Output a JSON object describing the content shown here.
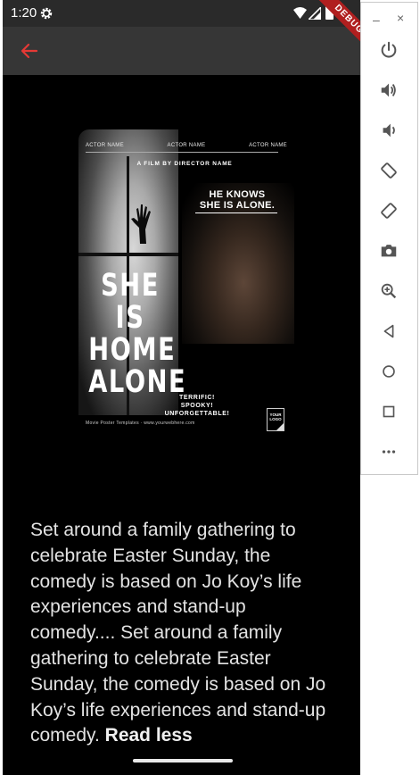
{
  "status_bar": {
    "time": "1:20",
    "icons": [
      "gear-icon",
      "wifi-icon",
      "signal-icon",
      "battery-icon"
    ]
  },
  "app_bar": {
    "back_icon": "arrow-back-icon",
    "accent": "#e53935"
  },
  "debug_banner": "DEBUG",
  "poster": {
    "actor_names": [
      "ACTOR NAME",
      "ACTOR NAME",
      "ACTOR NAME"
    ],
    "film_by": "A FILM BY DIRECTOR NAME",
    "tagline_line1": "HE KNOWS",
    "tagline_line2": "SHE IS ALONE.",
    "title_line1": "SHE IS",
    "title_line2": "HOME",
    "title_line3": "ALONE",
    "blurb_line1": "TERRIFIC!",
    "blurb_line2": "SPOOKY!",
    "blurb_line3": "UNFORGETTABLE!",
    "credits": "Movie Poster Templates · www.yourwebhere.com",
    "logo_line1": "YOUR",
    "logo_line2": "LOGO"
  },
  "description": {
    "text": "Set around a family gathering to celebrate Easter Sunday, the comedy is based on Jo Koy’s life experiences and stand-up comedy.... Set around a family gathering to celebrate Easter Sunday, the comedy is based on Jo Koy’s life experiences and stand-up comedy.",
    "toggle_label": "Read less"
  },
  "emulator_toolbar": {
    "minimize_label": "–",
    "close_label": "×",
    "buttons": [
      "power-icon",
      "volume-up-icon",
      "volume-down-icon",
      "rotate-left-icon",
      "rotate-right-icon",
      "camera-icon",
      "zoom-icon",
      "back-triangle-icon",
      "home-circle-icon",
      "overview-square-icon",
      "more-icon"
    ]
  }
}
